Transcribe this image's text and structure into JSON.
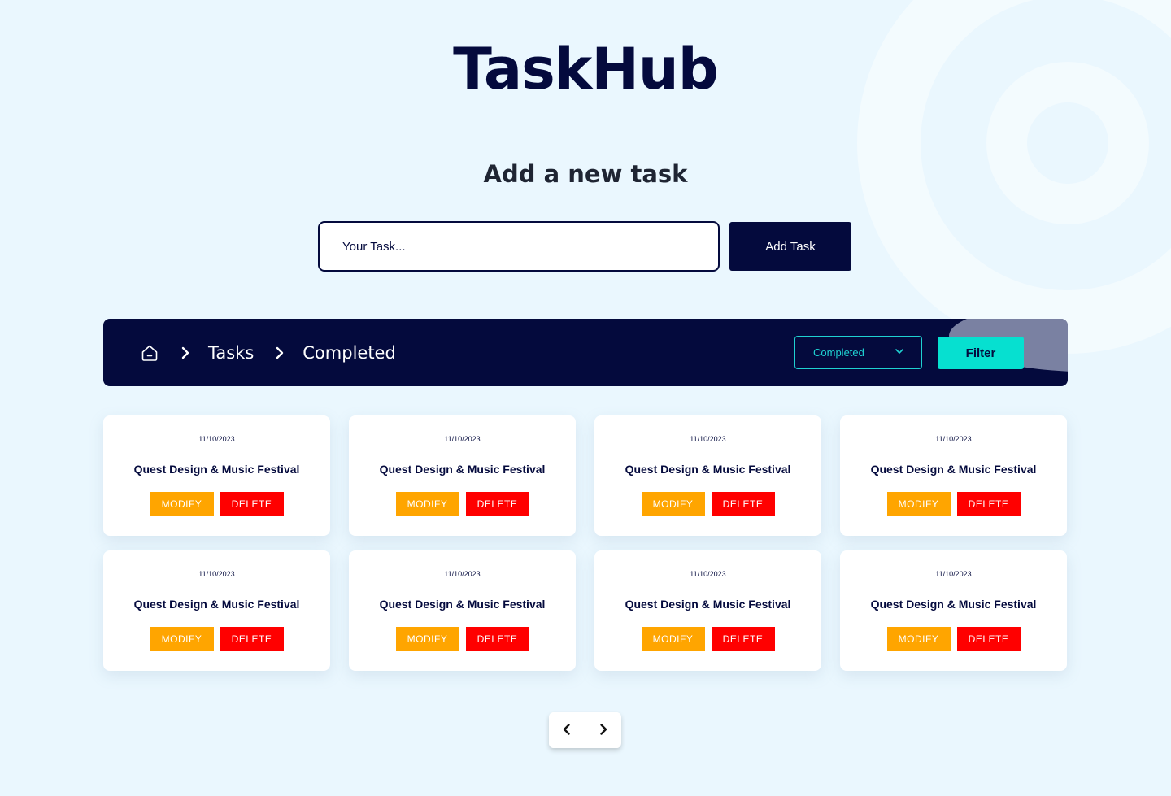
{
  "app": {
    "title": "TaskHub"
  },
  "form": {
    "heading": "Add a new task",
    "input_placeholder": "Your Task...",
    "add_label": "Add Task"
  },
  "toolbar": {
    "breadcrumb": [
      {
        "icon": "home-icon"
      },
      {
        "label": "Tasks"
      },
      {
        "label": "Completed"
      }
    ],
    "filter_select": {
      "selected": "Completed"
    },
    "filter_label": "Filter"
  },
  "tasks": [
    {
      "date": "11/10/2023",
      "title": "Quest Design & Music Festival",
      "modify": "MODIFY",
      "delete": "DELETE"
    },
    {
      "date": "11/10/2023",
      "title": "Quest Design & Music Festival",
      "modify": "MODIFY",
      "delete": "DELETE"
    },
    {
      "date": "11/10/2023",
      "title": "Quest Design & Music Festival",
      "modify": "MODIFY",
      "delete": "DELETE"
    },
    {
      "date": "11/10/2023",
      "title": "Quest Design & Music Festival",
      "modify": "MODIFY",
      "delete": "DELETE"
    },
    {
      "date": "11/10/2023",
      "title": "Quest Design & Music Festival",
      "modify": "MODIFY",
      "delete": "DELETE"
    },
    {
      "date": "11/10/2023",
      "title": "Quest Design & Music Festival",
      "modify": "MODIFY",
      "delete": "DELETE"
    },
    {
      "date": "11/10/2023",
      "title": "Quest Design & Music Festival",
      "modify": "MODIFY",
      "delete": "DELETE"
    },
    {
      "date": "11/10/2023",
      "title": "Quest Design & Music Festival",
      "modify": "MODIFY",
      "delete": "DELETE"
    }
  ],
  "pagination": {
    "prev_icon": "chevron-left-icon",
    "next_icon": "chevron-right-icon"
  },
  "colors": {
    "background": "#eaf7fe",
    "navy": "#040a3d",
    "accent_cyan": "#06e0d0",
    "modify": "#ffa500",
    "delete": "#ff0000"
  }
}
